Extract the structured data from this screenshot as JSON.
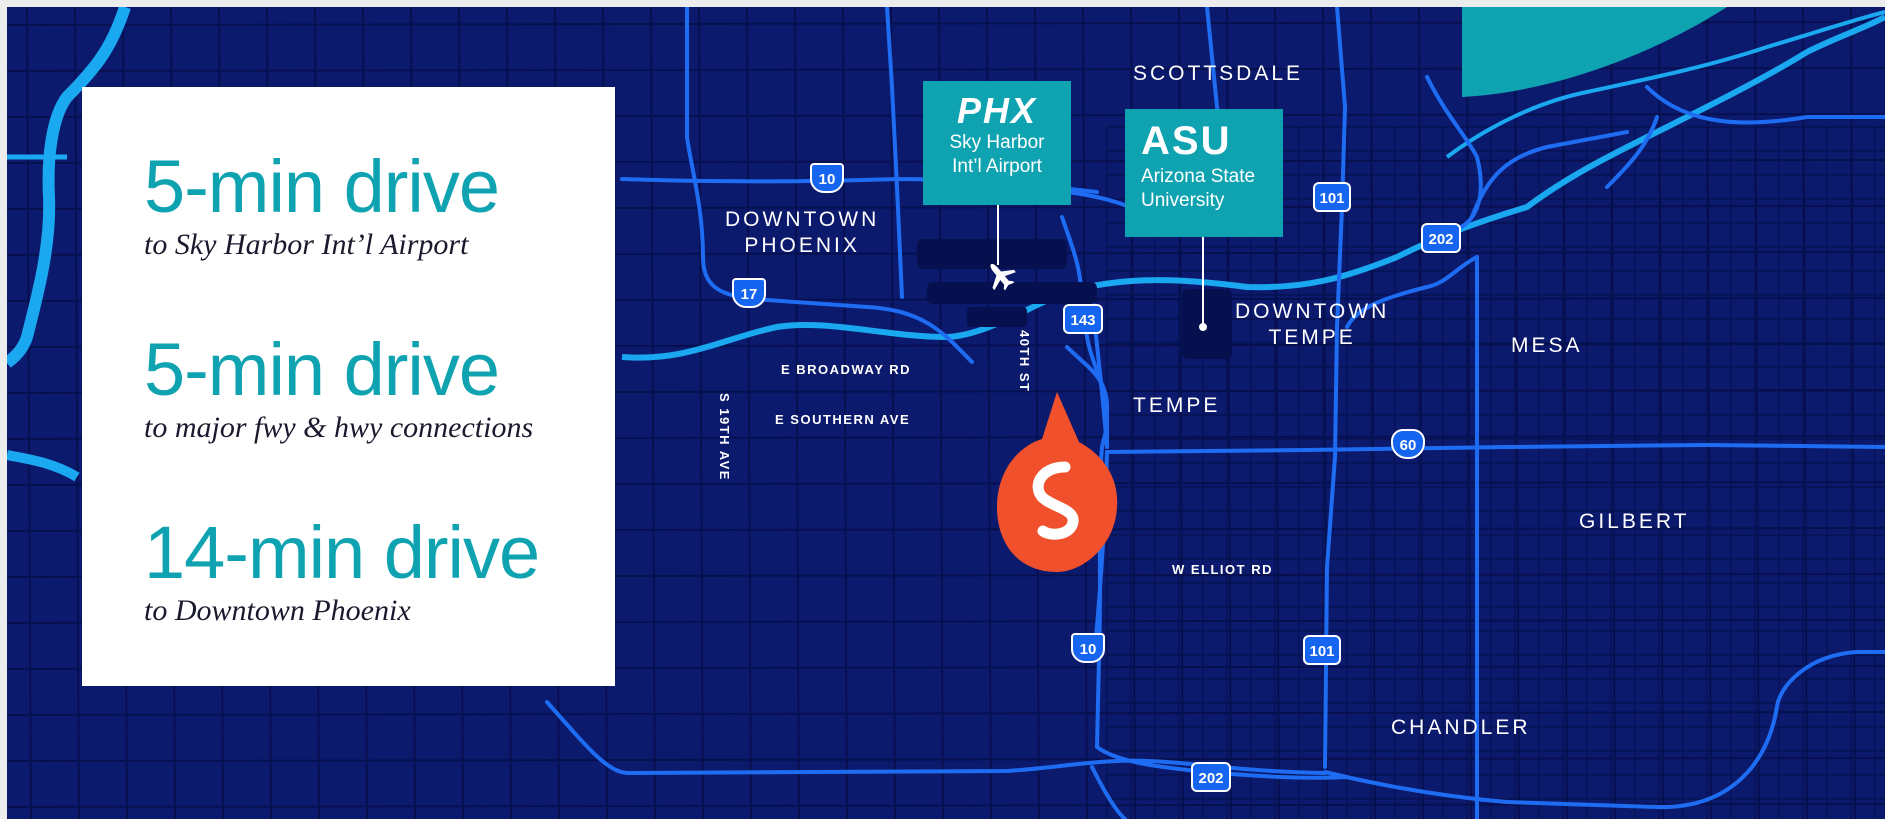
{
  "info_panel": {
    "items": [
      {
        "time": "5-min drive",
        "desc": "to Sky Harbor Int’l Airport"
      },
      {
        "time": "5-min drive",
        "desc": "to major fwy & hwy connections"
      },
      {
        "time": "14-min drive",
        "desc": "to Downtown Phoenix"
      }
    ]
  },
  "map": {
    "colors": {
      "background": "#0c1a6e",
      "street": "#07104f",
      "highway": "#1e6cf2",
      "water": "#1aa8f0",
      "teal": "#0fa3b1",
      "marker": "#f0502b"
    },
    "cities": {
      "scottsdale": "SCOTTSDALE",
      "downtown_phoenix": [
        "DOWNTOWN",
        "PHOENIX"
      ],
      "downtown_tempe": [
        "DOWNTOWN",
        "TEMPE"
      ],
      "mesa": "MESA",
      "tempe": "TEMPE",
      "gilbert": "GILBERT",
      "chandler": "CHANDLER"
    },
    "streets": {
      "broadway": "E BROADWAY RD",
      "southern": "E SOUTHERN AVE",
      "s19th": "S 19TH AVE",
      "st40": "40TH ST",
      "elliot": "W ELLIOT RD"
    },
    "shields": {
      "i10_north": "10",
      "i17": "17",
      "sr143": "143",
      "l101_north": "101",
      "l202_east": "202",
      "us60": "60",
      "i10_south": "10",
      "l101_south": "101",
      "l202_south": "202"
    },
    "pois": {
      "airport": {
        "logo": "PHX",
        "name": [
          "Sky Harbor",
          "Int’l Airport"
        ]
      },
      "asu": {
        "logo": "ASU",
        "name": [
          "Arizona State",
          "University"
        ]
      }
    }
  }
}
